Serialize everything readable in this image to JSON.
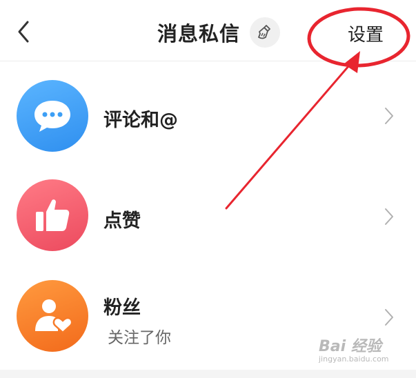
{
  "header": {
    "title": "消息私信",
    "settings_label": "设置"
  },
  "icons": {
    "back": "chevron-left-icon",
    "clean": "broom-icon",
    "comments": "chat-bubble-icon",
    "likes": "thumbs-up-icon",
    "fans": "user-heart-icon",
    "row_arrow": "chevron-right-icon"
  },
  "list": [
    {
      "title": "评论和@",
      "subtitle": "",
      "color": "#3d9ff5"
    },
    {
      "title": "点赞",
      "subtitle": "",
      "color": "#f2586a"
    },
    {
      "title": "粉丝",
      "subtitle": "关注了你",
      "color": "#f77b28"
    }
  ],
  "annotation": {
    "color": "#e8252f"
  },
  "watermark": {
    "main": "Bai 经验",
    "sub": "jingyan.baidu.com"
  }
}
